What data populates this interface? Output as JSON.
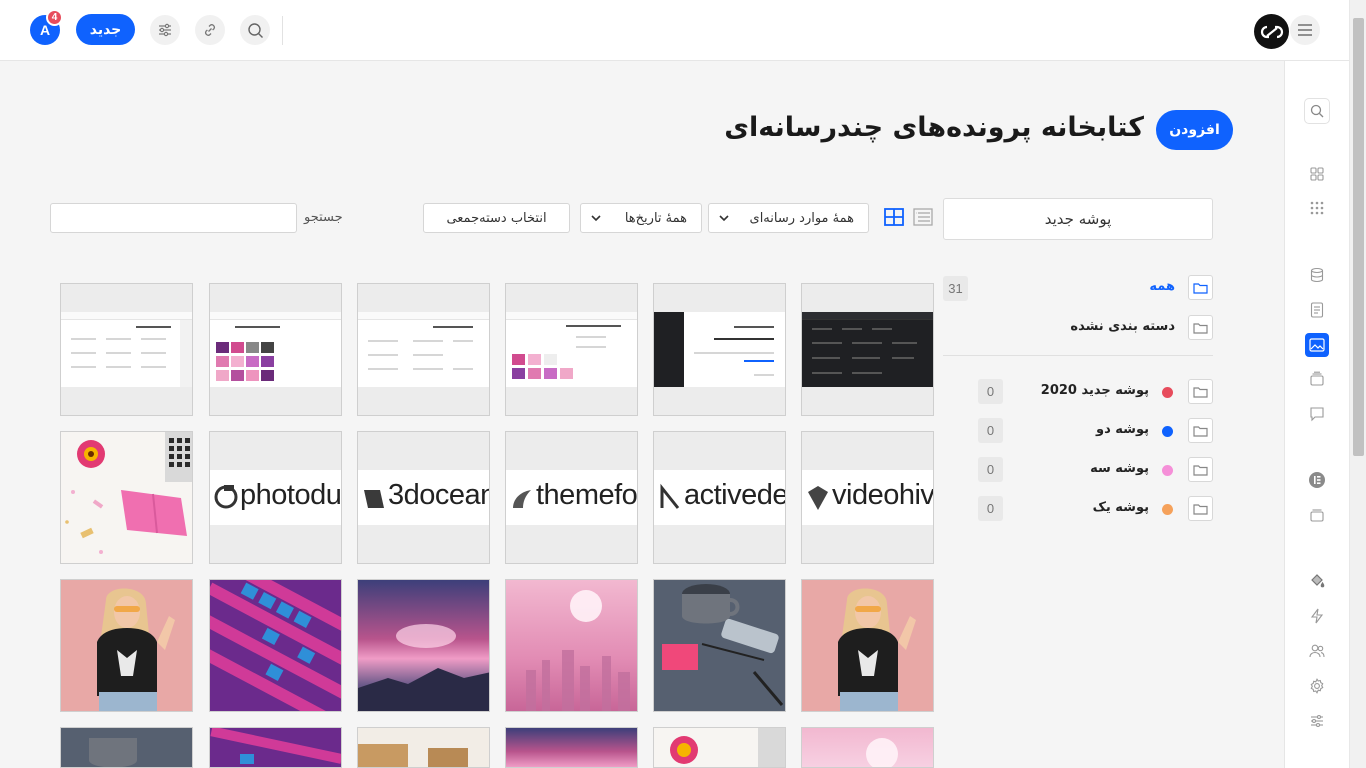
{
  "topbar": {
    "avatar_letter": "A",
    "notification_count": "4",
    "new_button": "جدید"
  },
  "header": {
    "title": "کتابخانه پرونده‌های چندرسانه‌ای",
    "add_button": "افزودن"
  },
  "toolbar": {
    "new_folder_placeholder": "پوشه جدید",
    "media_type_filter": "همهٔ موارد رسانه‌ای",
    "date_filter": "همهٔ تاریخ‌ها",
    "bulk_select": "انتخاب دسته‌جمعی",
    "search_label": "جستجو",
    "search_value": ""
  },
  "folders": {
    "all": {
      "label": "همه",
      "count": "31"
    },
    "uncategorized": {
      "label": "دسته بندی نشده"
    },
    "items": [
      {
        "label": "پوشه جدید 2020",
        "color": "#e74c5c",
        "count": "0"
      },
      {
        "label": "پوشه دو",
        "color": "#0f62fe",
        "count": "0"
      },
      {
        "label": "پوشه سه",
        "color": "#f58fd8",
        "count": "0"
      },
      {
        "label": "پوشه یک",
        "color": "#f5a15a",
        "count": "0"
      }
    ]
  },
  "media": {
    "brands": [
      "videohive",
      "activeden",
      "themeforest",
      "3docean",
      "photodune"
    ]
  },
  "colors": {
    "accent": "#0f62fe",
    "background": "#f5f5f5"
  }
}
